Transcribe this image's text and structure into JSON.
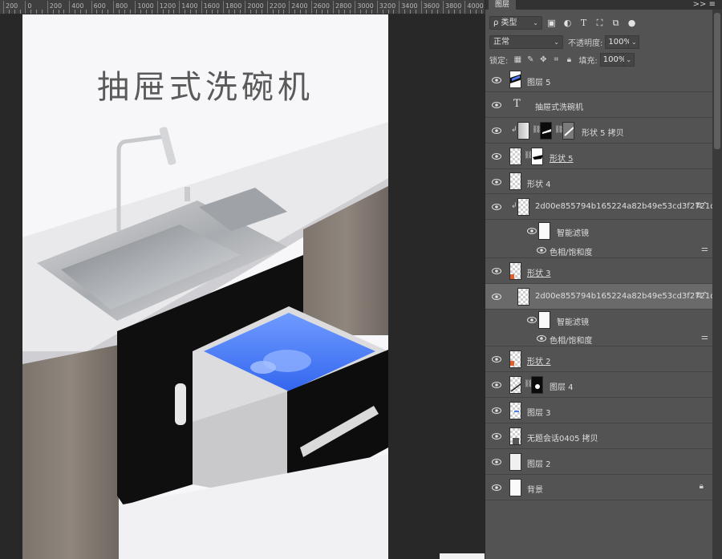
{
  "ruler": {
    "labels": [
      "200",
      "0",
      "200",
      "400",
      "600",
      "800",
      "1000",
      "1200",
      "1400",
      "1600",
      "1800",
      "2000",
      "2200",
      "2400",
      "2600",
      "2800",
      "3000",
      "3200",
      "3400",
      "3600",
      "3800",
      "4000"
    ]
  },
  "canvas": {
    "title": "抽屉式洗碗机"
  },
  "panel": {
    "tab": "图层",
    "menu": ">>  ≡",
    "filter_label": "ρ 类型",
    "blend_mode": "正常",
    "opacity_label": "不透明度:",
    "opacity_value": "100%",
    "lock_label": "锁定:",
    "fill_label": "填充:",
    "fill_value": "100%"
  },
  "layers": [
    {
      "name": "图层 5",
      "type": "image"
    },
    {
      "name": "抽屉式洗碗机",
      "type": "text"
    },
    {
      "name": "形状 5 拷贝",
      "type": "shape-masked",
      "clipped": true
    },
    {
      "name": "形状 5",
      "type": "shape-masked"
    },
    {
      "name": "形状 4",
      "type": "shape"
    },
    {
      "name": "2d00e855794b165224a82b49e53cd3f2721dc9501...",
      "type": "smart-object",
      "clipped": true
    },
    {
      "name": "智能滤镜",
      "type": "smart-filter-mask"
    },
    {
      "name": "色相/饱和度",
      "type": "filter"
    },
    {
      "name": "形状 3",
      "type": "shape"
    },
    {
      "name": "2d00e855794b165224a82b49e53cd3f2721dc9501...",
      "type": "smart-object",
      "selected": true
    },
    {
      "name": "智能滤镜",
      "type": "smart-filter-mask"
    },
    {
      "name": "色相/饱和度",
      "type": "filter"
    },
    {
      "name": "形状 2",
      "type": "shape"
    },
    {
      "name": "图层 4",
      "type": "masked"
    },
    {
      "name": "图层 3",
      "type": "image"
    },
    {
      "name": "无题会话0405 拷贝",
      "type": "image"
    },
    {
      "name": "图层 2",
      "type": "image"
    },
    {
      "name": "背景",
      "type": "background",
      "locked": true
    }
  ],
  "colors": {
    "panel_bg": "#535353",
    "selected_row": "#6a6a6a",
    "canvas_bg": "#f7f7f9",
    "drawer_blue": "#4f7df7"
  }
}
